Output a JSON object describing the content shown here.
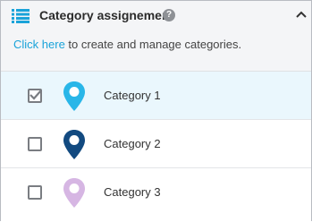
{
  "header": {
    "title": "Category assignement",
    "list_icon": "list-icon",
    "help_icon": "help-icon",
    "help_symbol": "?",
    "caret_icon": "chevron-up-icon",
    "accent_color": "#1aa3d9"
  },
  "intro": {
    "link_text": "Click here",
    "rest_text": " to create and manage categories."
  },
  "categories": [
    {
      "label": "Category 1",
      "checked": true,
      "pin_color": "#29b6e8",
      "pin_icon": "map-pin-icon"
    },
    {
      "label": "Category 2",
      "checked": false,
      "pin_color": "#124a80",
      "pin_icon": "map-pin-icon"
    },
    {
      "label": "Category 3",
      "checked": false,
      "pin_color": "#d6b6e3",
      "pin_icon": "map-pin-icon"
    }
  ]
}
